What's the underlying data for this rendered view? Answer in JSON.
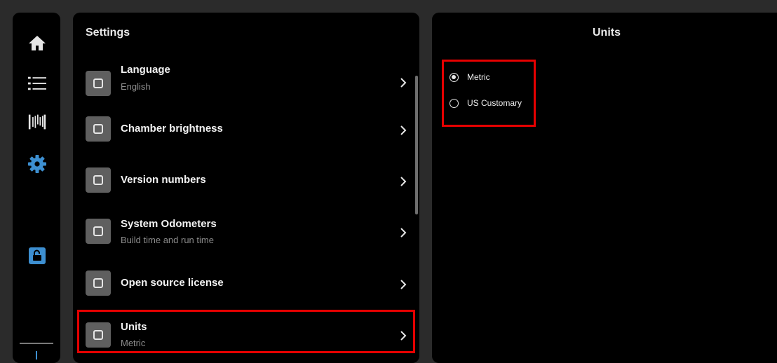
{
  "nav": {
    "items": [
      {
        "icon": "home-icon"
      },
      {
        "icon": "list-icon"
      },
      {
        "icon": "barcode-icon"
      },
      {
        "icon": "gear-icon",
        "active": true
      },
      {
        "icon": "unlock-icon"
      }
    ],
    "active_color": "#3d8fd1"
  },
  "settings": {
    "title": "Settings",
    "items": [
      {
        "title": "Language",
        "subtitle": "English"
      },
      {
        "title": "Chamber brightness",
        "subtitle": ""
      },
      {
        "title": "Version numbers",
        "subtitle": ""
      },
      {
        "title": "System Odometers",
        "subtitle": "Build time and run time"
      },
      {
        "title": "Open source license",
        "subtitle": ""
      },
      {
        "title": "Units",
        "subtitle": "Metric"
      }
    ]
  },
  "units": {
    "title": "Units",
    "options": [
      {
        "label": "Metric",
        "selected": true
      },
      {
        "label": "US Customary",
        "selected": false
      }
    ]
  },
  "colors": {
    "highlight": "#e60000"
  }
}
